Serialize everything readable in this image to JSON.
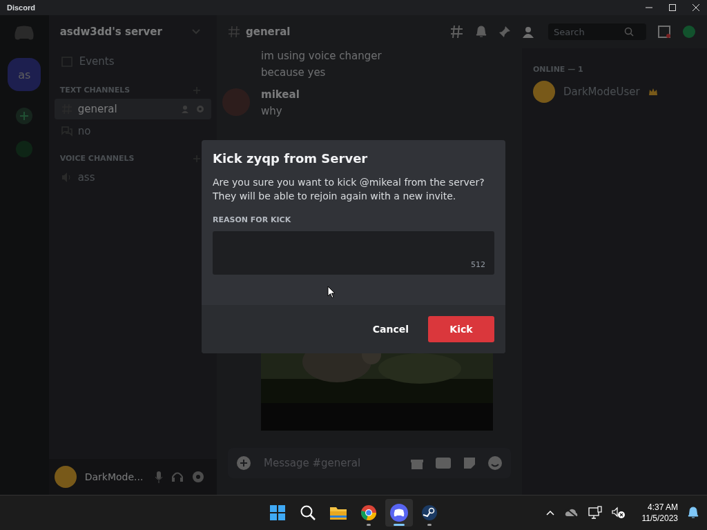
{
  "window": {
    "title": "Discord"
  },
  "server_rail": {
    "servers": [
      {
        "label": "as",
        "selected": true
      }
    ]
  },
  "channel_sidebar": {
    "server_name": "asdw3dd's server",
    "events": "Events",
    "categories": [
      {
        "title": "TEXT CHANNELS",
        "channels": [
          {
            "kind": "text",
            "name": "general",
            "selected": true
          },
          {
            "kind": "forum",
            "name": "no",
            "selected": false
          }
        ]
      },
      {
        "title": "VOICE CHANNELS",
        "channels": [
          {
            "kind": "voice",
            "name": "ass",
            "selected": false
          }
        ]
      }
    ]
  },
  "user_panel": {
    "name": "DarkMode..."
  },
  "chat": {
    "channel": "general",
    "search_placeholder": "Search",
    "composer_placeholder": "Message #general",
    "messages": [
      {
        "lines": [
          "im using voice changer",
          "because yes"
        ]
      },
      {
        "author": "mikeal",
        "lines": [
          "why"
        ]
      }
    ]
  },
  "members": {
    "section": "ONLINE — 1",
    "people": [
      {
        "name": "DarkModeUser",
        "owner": true
      }
    ]
  },
  "dialog": {
    "title": "Kick zyqp from Server",
    "body": "Are you sure you want to kick @mikeal from the server? They will be able to rejoin again with a new invite.",
    "field_label": "REASON FOR KICK",
    "counter": "512",
    "cancel": "Cancel",
    "confirm": "Kick"
  },
  "taskbar": {
    "apps": [
      {
        "kind": "windows",
        "running": false,
        "active": false
      },
      {
        "kind": "search",
        "running": false,
        "active": false
      },
      {
        "kind": "folder",
        "running": false,
        "active": false
      },
      {
        "kind": "browser",
        "running": true,
        "active": false
      },
      {
        "kind": "discord",
        "running": true,
        "active": true
      },
      {
        "kind": "steam",
        "running": true,
        "active": false
      }
    ],
    "time": "4:37 AM",
    "date": "11/5/2023"
  }
}
